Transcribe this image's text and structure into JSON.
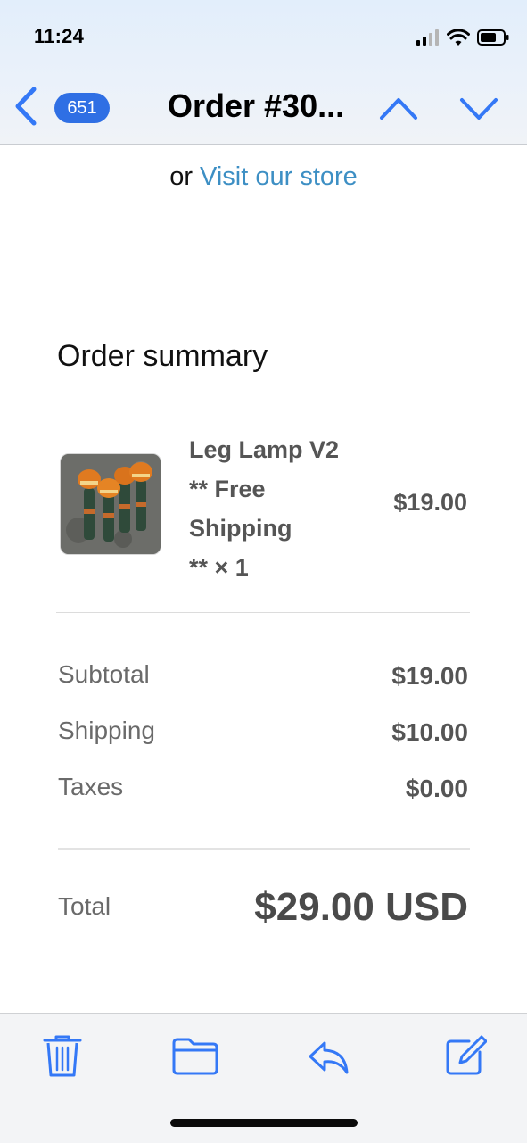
{
  "status_bar": {
    "time": "11:24"
  },
  "nav": {
    "unread_count": "651",
    "title": "Order #30..."
  },
  "email": {
    "visit_prefix": "or",
    "visit_link": "Visit our store",
    "order_summary_title": "Order summary",
    "item": {
      "name": "Leg Lamp V2\n** Free\nShipping\n** × 1",
      "price": "$19.00"
    },
    "lines": [
      {
        "label": "Subtotal",
        "value": "$19.00"
      },
      {
        "label": "Shipping",
        "value": "$10.00"
      },
      {
        "label": "Taxes",
        "value": "$0.00"
      }
    ],
    "total": {
      "label": "Total",
      "value": "$29.00 USD"
    }
  },
  "toolbar": {
    "icons": [
      "trash-icon",
      "folder-icon",
      "reply-icon",
      "compose-icon"
    ]
  },
  "colors": {
    "accent": "#2f6fe4",
    "link": "#3d8fc4",
    "icon": "#3478f6"
  }
}
